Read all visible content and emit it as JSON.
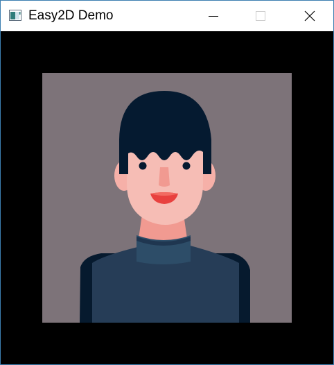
{
  "window": {
    "title": "Easy2D Demo",
    "controls": {
      "minimize_icon": "minimize-icon",
      "maximize_icon": "maximize-icon",
      "close_icon": "close-icon"
    }
  },
  "colors": {
    "window_border": "#3c7fb1",
    "client_background": "#000000",
    "portrait_background": "#7d7379",
    "hair": "#051a30",
    "skin": "#f6bdb5",
    "skin_shadow": "#f19a91",
    "lips": "#e8413f",
    "sweater": "#263d57",
    "collar": "#2d4d68"
  }
}
